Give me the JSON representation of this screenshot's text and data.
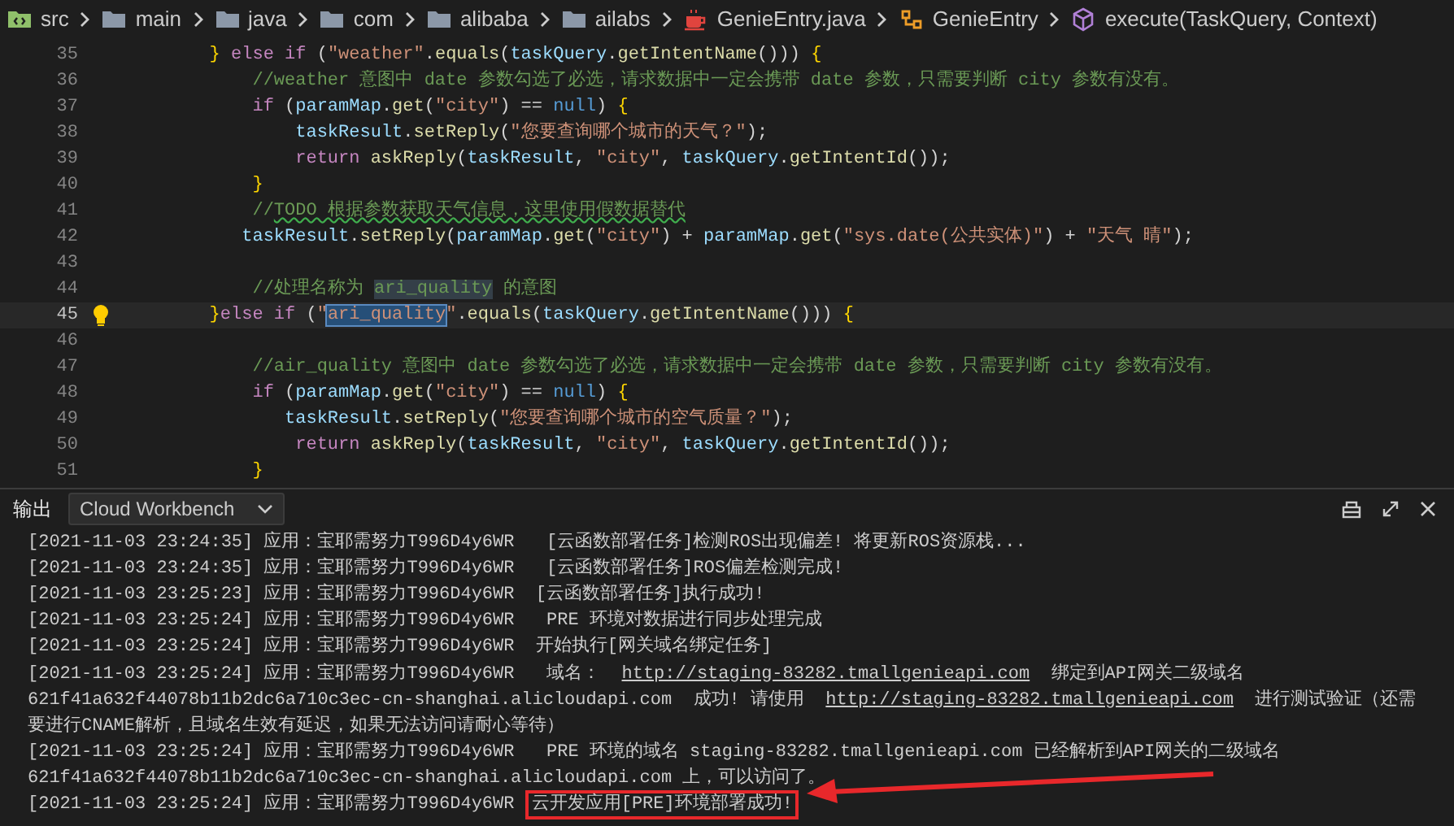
{
  "breadcrumb": [
    {
      "kind": "source-folder",
      "label": "src"
    },
    {
      "kind": "folder",
      "label": "main"
    },
    {
      "kind": "folder",
      "label": "java"
    },
    {
      "kind": "folder",
      "label": "com"
    },
    {
      "kind": "folder",
      "label": "alibaba"
    },
    {
      "kind": "folder",
      "label": "ailabs"
    },
    {
      "kind": "java-file",
      "label": "GenieEntry.java"
    },
    {
      "kind": "class",
      "label": "GenieEntry"
    },
    {
      "kind": "method",
      "label": "execute(TaskQuery, Context)"
    }
  ],
  "editor": {
    "lines": [
      {
        "number": "35",
        "current": false,
        "tokens": [
          {
            "kind": "br",
            "text": "        }"
          },
          {
            "kind": "kw",
            "text": " else if"
          },
          {
            "kind": "p",
            "text": " ("
          },
          {
            "kind": "str",
            "text": "\"weather\""
          },
          {
            "kind": "p",
            "text": "."
          },
          {
            "kind": "fn",
            "text": "equals"
          },
          {
            "kind": "p",
            "text": "("
          },
          {
            "kind": "var",
            "text": "taskQuery"
          },
          {
            "kind": "p",
            "text": "."
          },
          {
            "kind": "fn",
            "text": "getIntentName"
          },
          {
            "kind": "p",
            "text": "())) "
          },
          {
            "kind": "br",
            "text": "{"
          }
        ]
      },
      {
        "number": "36",
        "current": false,
        "tokens": [
          {
            "kind": "cmt",
            "text": "            //weather 意图中 date 参数勾选了必选，请求数据中一定会携带 date 参数，只需要判断 city 参数有没有。"
          }
        ]
      },
      {
        "number": "37",
        "current": false,
        "tokens": [
          {
            "kind": "kw",
            "text": "            if"
          },
          {
            "kind": "p",
            "text": " ("
          },
          {
            "kind": "var",
            "text": "paramMap"
          },
          {
            "kind": "p",
            "text": "."
          },
          {
            "kind": "fn",
            "text": "get"
          },
          {
            "kind": "p",
            "text": "("
          },
          {
            "kind": "str",
            "text": "\"city\""
          },
          {
            "kind": "p",
            "text": ") == "
          },
          {
            "kind": "const",
            "text": "null"
          },
          {
            "kind": "p",
            "text": ") "
          },
          {
            "kind": "br",
            "text": "{"
          }
        ]
      },
      {
        "number": "38",
        "current": false,
        "tokens": [
          {
            "kind": "var",
            "text": "                taskResult"
          },
          {
            "kind": "p",
            "text": "."
          },
          {
            "kind": "fn",
            "text": "setReply"
          },
          {
            "kind": "p",
            "text": "("
          },
          {
            "kind": "str",
            "text": "\"您要查询哪个城市的天气？\""
          },
          {
            "kind": "p",
            "text": ");"
          }
        ]
      },
      {
        "number": "39",
        "current": false,
        "tokens": [
          {
            "kind": "kw",
            "text": "                return"
          },
          {
            "kind": "fn",
            "text": " askReply"
          },
          {
            "kind": "p",
            "text": "("
          },
          {
            "kind": "var",
            "text": "taskResult"
          },
          {
            "kind": "p",
            "text": ", "
          },
          {
            "kind": "str",
            "text": "\"city\""
          },
          {
            "kind": "p",
            "text": ", "
          },
          {
            "kind": "var",
            "text": "taskQuery"
          },
          {
            "kind": "p",
            "text": "."
          },
          {
            "kind": "fn",
            "text": "getIntentId"
          },
          {
            "kind": "p",
            "text": "());"
          }
        ]
      },
      {
        "number": "40",
        "current": false,
        "tokens": [
          {
            "kind": "br",
            "text": "            }"
          }
        ]
      },
      {
        "number": "41",
        "current": false,
        "tokens": [
          {
            "kind": "cmt",
            "text": "            //"
          },
          {
            "kind": "cmt",
            "text": "TODO 根据参数获取天气信息，这里使用假数据替代",
            "squiggle": true
          }
        ]
      },
      {
        "number": "42",
        "current": false,
        "tokens": [
          {
            "kind": "var",
            "text": "           taskResult"
          },
          {
            "kind": "p",
            "text": "."
          },
          {
            "kind": "fn",
            "text": "setReply"
          },
          {
            "kind": "p",
            "text": "("
          },
          {
            "kind": "var",
            "text": "paramMap"
          },
          {
            "kind": "p",
            "text": "."
          },
          {
            "kind": "fn",
            "text": "get"
          },
          {
            "kind": "p",
            "text": "("
          },
          {
            "kind": "str",
            "text": "\"city\""
          },
          {
            "kind": "p",
            "text": ") + "
          },
          {
            "kind": "var",
            "text": "paramMap"
          },
          {
            "kind": "p",
            "text": "."
          },
          {
            "kind": "fn",
            "text": "get"
          },
          {
            "kind": "p",
            "text": "("
          },
          {
            "kind": "str",
            "text": "\"sys.date(公共实体)\""
          },
          {
            "kind": "p",
            "text": ") + "
          },
          {
            "kind": "str",
            "text": "\"天气 晴\""
          },
          {
            "kind": "p",
            "text": ");"
          }
        ]
      },
      {
        "number": "43",
        "current": false
      },
      {
        "number": "44",
        "current": false,
        "tokens": [
          {
            "kind": "cmt",
            "text": "            //处理名称为 "
          },
          {
            "kind": "cmt",
            "text": "ari_quality",
            "highlighted": true
          },
          {
            "kind": "cmt",
            "text": " 的意图"
          }
        ]
      },
      {
        "number": "45",
        "current": true,
        "lightbulb": true,
        "tokens": [
          {
            "kind": "br",
            "text": "        }"
          },
          {
            "kind": "kw",
            "text": "else if"
          },
          {
            "kind": "p",
            "text": " ("
          },
          {
            "kind": "str",
            "text": "\""
          },
          {
            "kind": "str",
            "text": "ari_quality",
            "selected": true
          },
          {
            "kind": "str",
            "text": "\""
          },
          {
            "kind": "p",
            "text": "."
          },
          {
            "kind": "fn",
            "text": "equals"
          },
          {
            "kind": "p",
            "text": "("
          },
          {
            "kind": "var",
            "text": "taskQuery"
          },
          {
            "kind": "p",
            "text": "."
          },
          {
            "kind": "fn",
            "text": "getIntentName"
          },
          {
            "kind": "p",
            "text": "())) "
          },
          {
            "kind": "br",
            "text": "{"
          }
        ]
      },
      {
        "number": "46",
        "current": false
      },
      {
        "number": "47",
        "current": false,
        "tokens": [
          {
            "kind": "cmt",
            "text": "            //air_quality 意图中 date 参数勾选了必选，请求数据中一定会携带 date 参数，只需要判断 city 参数有没有。"
          }
        ]
      },
      {
        "number": "48",
        "current": false,
        "tokens": [
          {
            "kind": "kw",
            "text": "            if"
          },
          {
            "kind": "p",
            "text": " ("
          },
          {
            "kind": "var",
            "text": "paramMap"
          },
          {
            "kind": "p",
            "text": "."
          },
          {
            "kind": "fn",
            "text": "get"
          },
          {
            "kind": "p",
            "text": "("
          },
          {
            "kind": "str",
            "text": "\"city\""
          },
          {
            "kind": "p",
            "text": ") == "
          },
          {
            "kind": "const",
            "text": "null"
          },
          {
            "kind": "p",
            "text": ") "
          },
          {
            "kind": "br",
            "text": "{"
          }
        ]
      },
      {
        "number": "49",
        "current": false,
        "tokens": [
          {
            "kind": "var",
            "text": "               taskResult"
          },
          {
            "kind": "p",
            "text": "."
          },
          {
            "kind": "fn",
            "text": "setReply"
          },
          {
            "kind": "p",
            "text": "("
          },
          {
            "kind": "str",
            "text": "\"您要查询哪个城市的空气质量？\""
          },
          {
            "kind": "p",
            "text": ");"
          }
        ]
      },
      {
        "number": "50",
        "current": false,
        "tokens": [
          {
            "kind": "kw",
            "text": "                return"
          },
          {
            "kind": "fn",
            "text": " askReply"
          },
          {
            "kind": "p",
            "text": "("
          },
          {
            "kind": "var",
            "text": "taskResult"
          },
          {
            "kind": "p",
            "text": ", "
          },
          {
            "kind": "str",
            "text": "\"city\""
          },
          {
            "kind": "p",
            "text": ", "
          },
          {
            "kind": "var",
            "text": "taskQuery"
          },
          {
            "kind": "p",
            "text": "."
          },
          {
            "kind": "fn",
            "text": "getIntentId"
          },
          {
            "kind": "p",
            "text": "());"
          }
        ]
      },
      {
        "number": "51",
        "current": false,
        "tokens": [
          {
            "kind": "br",
            "text": "            }"
          }
        ]
      }
    ]
  },
  "panel": {
    "title": "输出",
    "channel": "Cloud Workbench",
    "lines": [
      [
        {
          "kind": "text",
          "text": "[2021-11-03 23:24:35] 应用：宝耶需努力T996D4y6WR   [云函数部署任务]检测ROS出现偏差! 将更新ROS资源栈..."
        }
      ],
      [
        {
          "kind": "text",
          "text": "[2021-11-03 23:24:35] 应用：宝耶需努力T996D4y6WR   [云函数部署任务]ROS偏差检测完成!"
        }
      ],
      [
        {
          "kind": "text",
          "text": "[2021-11-03 23:25:23] 应用：宝耶需努力T996D4y6WR  [云函数部署任务]执行成功!"
        }
      ],
      [
        {
          "kind": "text",
          "text": "[2021-11-03 23:25:24] 应用：宝耶需努力T996D4y6WR   PRE 环境对数据进行同步处理完成"
        }
      ],
      [
        {
          "kind": "text",
          "text": "[2021-11-03 23:25:24] 应用：宝耶需努力T996D4y6WR  开始执行[网关域名绑定任务]"
        }
      ],
      [
        {
          "kind": "text",
          "text": "[2021-11-03 23:25:24] 应用：宝耶需努力T996D4y6WR   域名：  "
        },
        {
          "kind": "link",
          "text": "http://staging-83282.tmallgenieapi.com"
        },
        {
          "kind": "text",
          "text": "  绑定到API网关二级域名"
        }
      ],
      [
        {
          "kind": "text",
          "text": "621f41a632f44078b11b2dc6a710c3ec-cn-shanghai.alicloudapi.com  成功! 请使用  "
        },
        {
          "kind": "link",
          "text": "http://staging-83282.tmallgenieapi.com"
        },
        {
          "kind": "text",
          "text": "  进行测试验证（还需"
        }
      ],
      [
        {
          "kind": "text",
          "text": "要进行CNAME解析，且域名生效有延迟，如果无法访问请耐心等待）"
        }
      ],
      [
        {
          "kind": "text",
          "text": "[2021-11-03 23:25:24] 应用：宝耶需努力T996D4y6WR   PRE 环境的域名 staging-83282.tmallgenieapi.com 已经解析到API网关的二级域名"
        }
      ],
      [
        {
          "kind": "text",
          "text": "621f41a632f44078b11b2dc6a710c3ec-cn-shanghai.alicloudapi.com 上，可以访问了。"
        }
      ],
      [
        {
          "kind": "text",
          "text": "[2021-11-03 23:25:24] 应用：宝耶需努力T996D4y6WR "
        },
        {
          "kind": "boxed",
          "text": "云开发应用[PRE]环境部署成功!"
        }
      ]
    ]
  }
}
